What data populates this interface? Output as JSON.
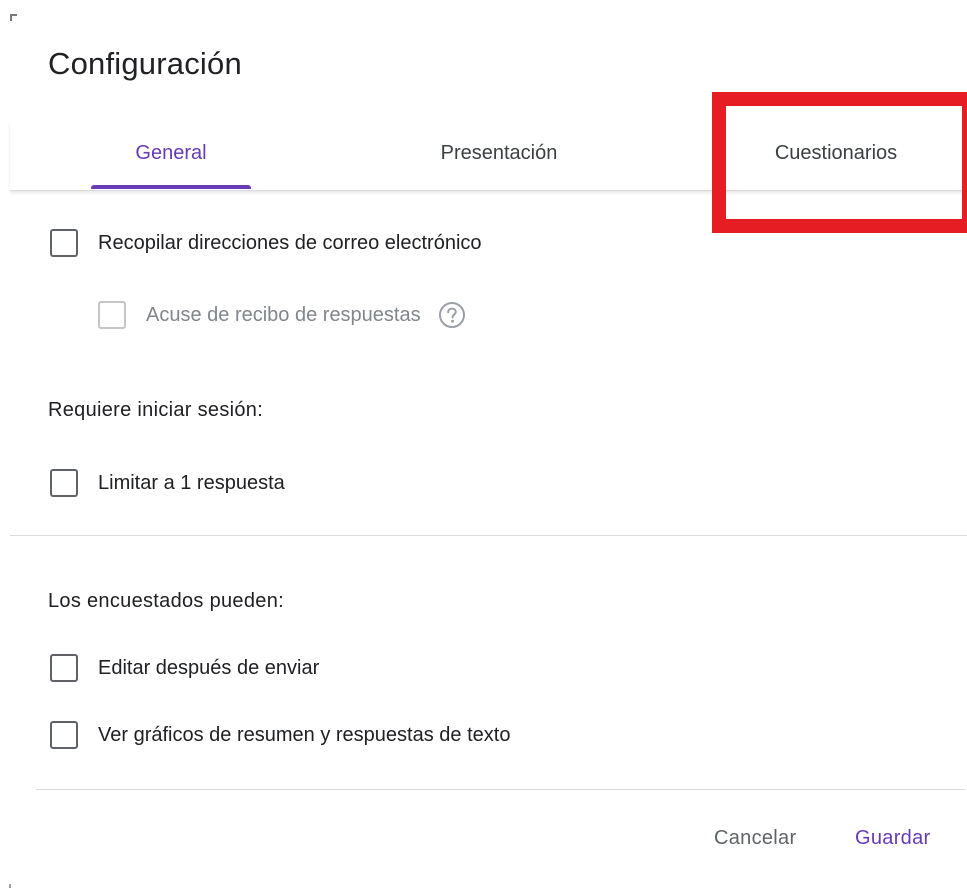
{
  "dialog": {
    "title": "Configuración"
  },
  "tabs": [
    {
      "label": "General",
      "active": true
    },
    {
      "label": "Presentación",
      "active": false
    },
    {
      "label": "Cuestionarios",
      "active": false
    }
  ],
  "general": {
    "collect_emails": {
      "label": "Recopilar direcciones de correo electrónico",
      "checked": false
    },
    "response_receipts": {
      "label": "Acuse de recibo de respuestas",
      "checked": false,
      "disabled": true,
      "help_icon": "help-circle-icon"
    },
    "requires_signin_heading": "Requiere iniciar sesión:",
    "limit_one_response": {
      "label": "Limitar a 1 respuesta",
      "checked": false
    },
    "respondents_can_heading": "Los encuestados pueden:",
    "edit_after_submit": {
      "label": "Editar después de enviar",
      "checked": false
    },
    "see_summary": {
      "label": "Ver gráficos de resumen y respuestas de texto",
      "checked": false
    }
  },
  "footer": {
    "cancel_label": "Cancelar",
    "save_label": "Guardar"
  },
  "colors": {
    "accent": "#673ab7",
    "highlight": "#e61d22",
    "divider": "#dadce0"
  }
}
